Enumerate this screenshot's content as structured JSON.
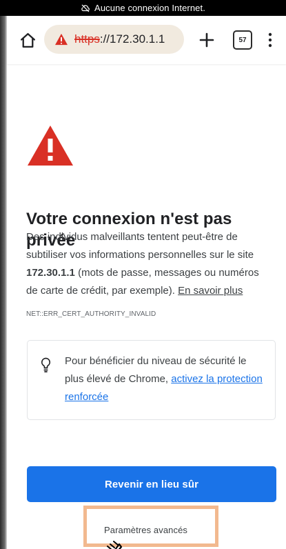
{
  "status_bar": {
    "offline_text": "Aucune connexion Internet.",
    "icon": "cloud-off-icon"
  },
  "browser": {
    "url": {
      "scheme": "https",
      "rest": "://172.30.1.1"
    },
    "tabs_count": "57",
    "icons": {
      "home": "home-icon",
      "warning": "warning-triangle-icon",
      "new_tab": "plus-icon",
      "tabs": "tabs-icon",
      "menu": "more-vertical-icon"
    },
    "colors": {
      "omnibox_bg": "#f1eadf",
      "warning_red": "#d93025"
    }
  },
  "error_page": {
    "title": "Votre connexion n'est pas privée",
    "explanation": {
      "before_host": "Des individus malveillants tentent peut-être de subtiliser vos informations personnelles sur le site ",
      "host": "172.30.1.1",
      "after_host": " (mots de passe, messages ou numéros de carte de crédit, par exemple). ",
      "learn_more": "En savoir plus"
    },
    "error_code": "NET::ERR_CERT_AUTHORITY_INVALID",
    "safe_browsing": {
      "icon": "lightbulb-icon",
      "text_before_link": "Pour bénéficier du niveau de sécurité le plus élevé de Chrome, ",
      "link": "activez la protection renforcée"
    },
    "primary_button": "Revenir en lieu sûr",
    "advanced_button": "Paramètres avancés",
    "colors": {
      "icon_red": "#d93025",
      "primary_blue": "#1a73e8",
      "highlight_orange": "#f2b98f",
      "text_gray": "#3c4043"
    }
  },
  "overlay": {
    "pointer_icon": "hand-pointer-icon"
  }
}
